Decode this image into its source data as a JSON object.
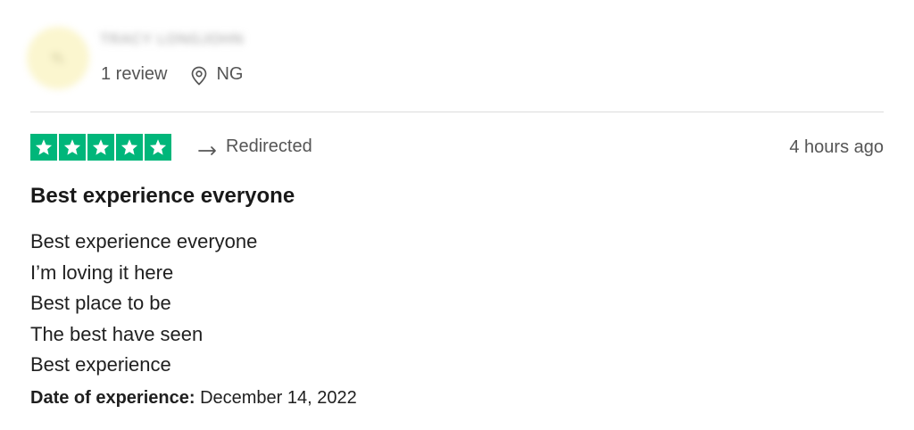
{
  "reviewer": {
    "avatar_initials": "TL",
    "name": "TRACY LONGJOHN",
    "review_count": "1 review",
    "location": "NG",
    "location_icon": "location-pin-icon"
  },
  "review": {
    "rating": 5,
    "star_color": "#00b67a",
    "star_icon": "star-icon",
    "source_icon": "redirect-arrow-icon",
    "source": "Redirected",
    "time_ago": "4 hours ago",
    "title": "Best experience everyone",
    "body_lines": [
      "Best experience everyone",
      "I’m loving it here",
      "Best place to be",
      "The best have seen",
      "Best experience"
    ],
    "date_label": "Date of experience:",
    "date_value": "December 14, 2022"
  }
}
